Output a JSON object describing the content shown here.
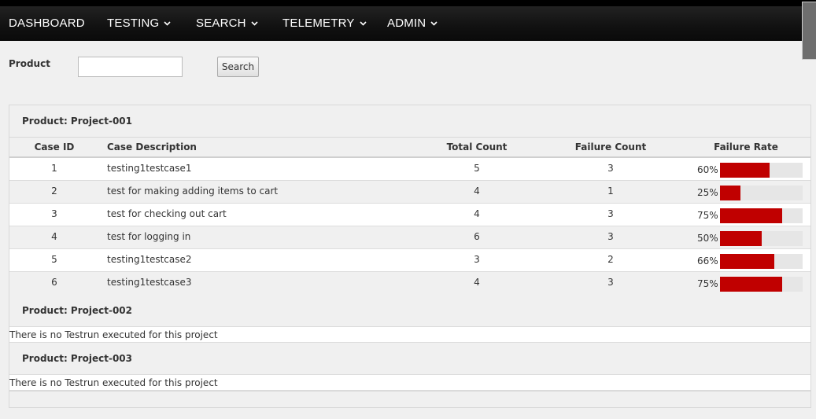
{
  "nav": {
    "items": [
      {
        "label": "DASHBOARD",
        "has_dropdown": false
      },
      {
        "label": "TESTING",
        "has_dropdown": true
      },
      {
        "label": "SEARCH",
        "has_dropdown": true
      },
      {
        "label": "TELEMETRY",
        "has_dropdown": true
      },
      {
        "label": "ADMIN",
        "has_dropdown": true
      }
    ]
  },
  "search": {
    "label": "Product",
    "value": "",
    "button_label": "Search"
  },
  "projects": [
    {
      "heading": "Product: Project-001",
      "columns": [
        "Case ID",
        "Case Description",
        "Total Count",
        "Failure Count",
        "Failure Rate"
      ],
      "rows": [
        {
          "id": "1",
          "description": "testing1testcase1",
          "total": "5",
          "failures": "3",
          "rate": "60%",
          "rate_value": 0.6
        },
        {
          "id": "2",
          "description": "test for making adding items to cart",
          "total": "4",
          "failures": "1",
          "rate": "25%",
          "rate_value": 0.25
        },
        {
          "id": "3",
          "description": "test for checking out cart",
          "total": "4",
          "failures": "3",
          "rate": "75%",
          "rate_value": 0.75
        },
        {
          "id": "4",
          "description": "test for logging in",
          "total": "6",
          "failures": "3",
          "rate": "50%",
          "rate_value": 0.5
        },
        {
          "id": "5",
          "description": "testing1testcase2",
          "total": "3",
          "failures": "2",
          "rate": "66%",
          "rate_value": 0.66
        },
        {
          "id": "6",
          "description": "testing1testcase3",
          "total": "4",
          "failures": "3",
          "rate": "75%",
          "rate_value": 0.75
        }
      ]
    },
    {
      "heading": "Product: Project-002",
      "empty_message": "There is no Testrun executed for this project"
    },
    {
      "heading": "Product: Project-003",
      "empty_message": "There is no Testrun executed for this project"
    }
  ],
  "colors": {
    "bar_fill": "#c00000",
    "bar_track": "#e6e6e6",
    "navbar": "#111111"
  }
}
